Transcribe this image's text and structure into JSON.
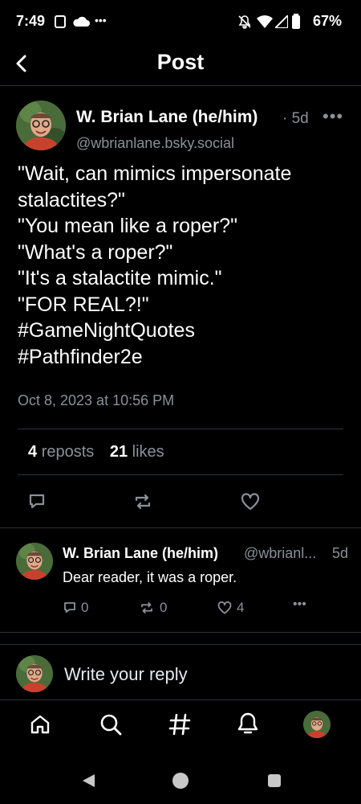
{
  "status_bar": {
    "time": "7:49",
    "battery": "67%"
  },
  "header": {
    "title": "Post"
  },
  "post": {
    "author": "W. Brian Lane (he/him)",
    "age": "· 5d",
    "handle": "@wbrianlane.bsky.social",
    "lines": [
      "\"Wait, can mimics impersonate",
      "stalactites?\"",
      "\"You mean like a roper?\"",
      "\"What's a roper?\"",
      "\"It's a stalactite mimic.\"",
      "\"FOR REAL?!\"",
      "#GameNightQuotes",
      "#Pathfinder2e"
    ],
    "date": "Oct 8, 2023 at 10:56 PM",
    "reposts_count": "4",
    "reposts_label": "reposts",
    "likes_count": "21",
    "likes_label": "likes"
  },
  "reply": {
    "author": "W. Brian Lane (he/him)",
    "handle": "@wbrianl...",
    "age": "5d",
    "text": "Dear reader, it was a roper.",
    "reply_count": "0",
    "repost_count": "0",
    "like_count": "4"
  },
  "composer": {
    "placeholder": "Write your reply"
  },
  "nav": {
    "items": [
      "home-icon",
      "search-icon",
      "hashtag-icon",
      "notifications-icon",
      "profile-avatar"
    ]
  },
  "colors": {
    "background": "#000000",
    "muted": "#8a9099",
    "divider": "#2e3338"
  }
}
